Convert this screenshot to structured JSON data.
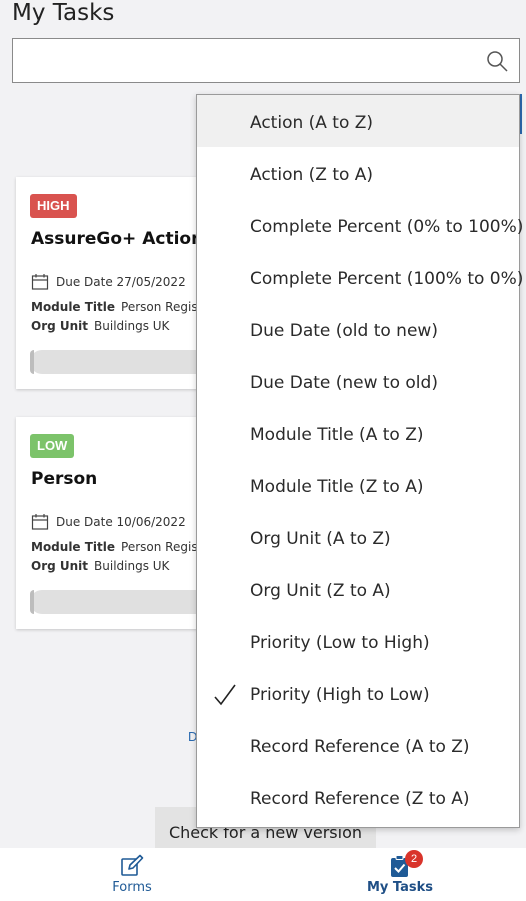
{
  "header": {
    "title": "My Tasks"
  },
  "search": {
    "value": "",
    "icon": "search-icon"
  },
  "tasks": [
    {
      "priority": "HIGH",
      "priority_color": "#d9534f",
      "title": "AssureGo+ Action",
      "due": "Due Date 27/05/2022",
      "module_label": "Module Title",
      "module_value": "Person Register",
      "org_label": "Org Unit",
      "org_value": "Buildings UK"
    },
    {
      "priority": "LOW",
      "priority_color": "#7cc36a",
      "title": "Person",
      "due": "Due Date 10/06/2022",
      "module_label": "Module Title",
      "module_value": "Person Register",
      "org_label": "Org Unit",
      "org_value": "Buildings UK"
    }
  ],
  "stray_link": "D",
  "version_button": "Check for a new version",
  "sort_menu": {
    "selected_index": 11,
    "hovered_index": 0,
    "options": [
      "Action (A to Z)",
      "Action (Z to A)",
      "Complete Percent (0% to 100%)",
      "Complete Percent (100% to 0%)",
      "Due Date (old to new)",
      "Due Date (new to old)",
      "Module Title (A to Z)",
      "Module Title (Z to A)",
      "Org Unit (A to Z)",
      "Org Unit (Z to A)",
      "Priority (Low to High)",
      "Priority (High to Low)",
      "Record Reference (A to Z)",
      "Record Reference (Z to A)"
    ]
  },
  "bottom_nav": {
    "forms_label": "Forms",
    "tasks_label": "My Tasks",
    "tasks_badge": "2",
    "active": "My Tasks"
  }
}
